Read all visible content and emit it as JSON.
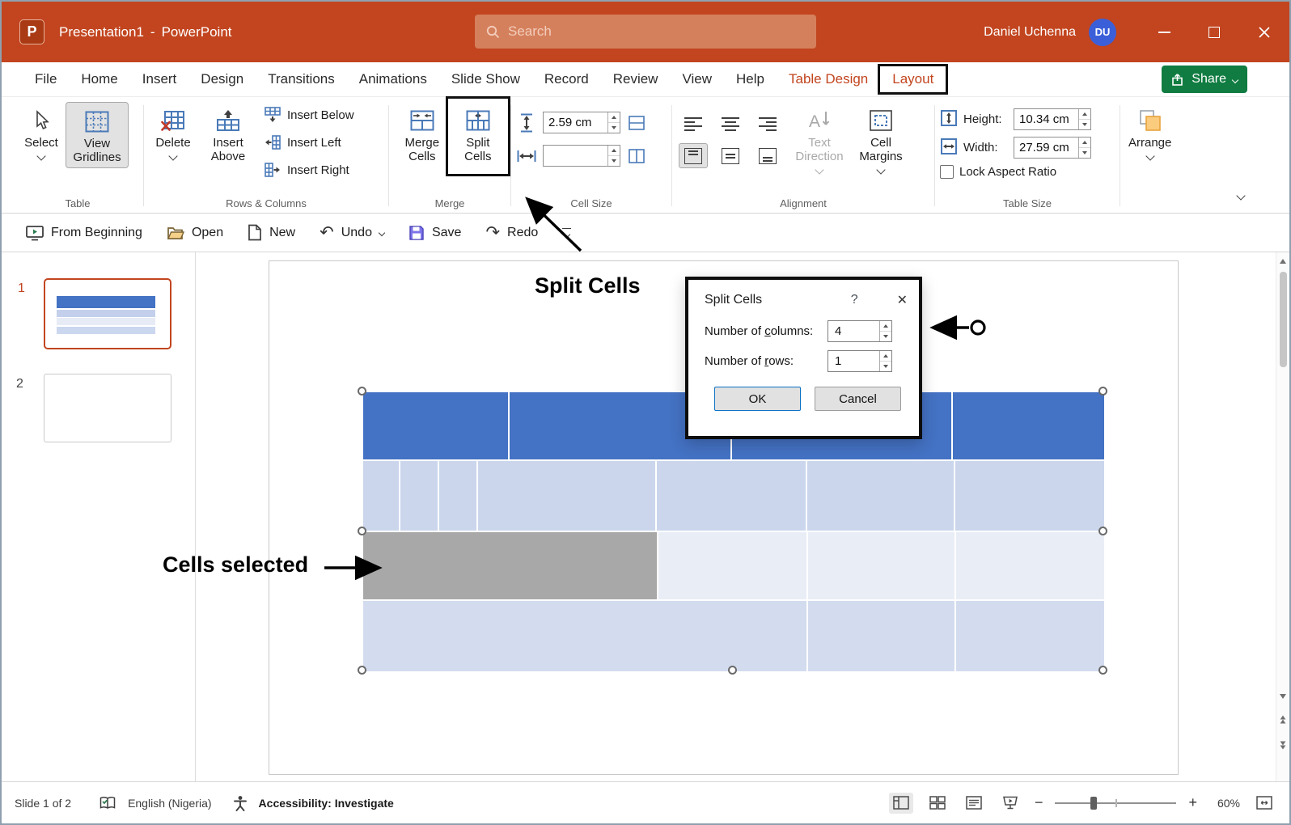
{
  "colors": {
    "titlebar": "#C2451F",
    "contextual_tab": "#C2451F",
    "share_green": "#107C41",
    "avatar_blue": "#3B5FD9",
    "table_header_blue": "#4472C4",
    "row_medium": "#CBD6EC",
    "row_light": "#E9EDF6",
    "row_bottom": "#D3DCEF",
    "selected_cells_gray": "#A8A8A8"
  },
  "title_bar": {
    "doc_name": "Presentation1",
    "separator": "-",
    "app_name": "PowerPoint",
    "logo_letter": "P",
    "search_placeholder": "Search",
    "user_name": "Daniel Uchenna",
    "user_initials": "DU"
  },
  "menu": {
    "tabs": [
      {
        "label": "File"
      },
      {
        "label": "Home"
      },
      {
        "label": "Insert"
      },
      {
        "label": "Design"
      },
      {
        "label": "Transitions"
      },
      {
        "label": "Animations"
      },
      {
        "label": "Slide Show"
      },
      {
        "label": "Record"
      },
      {
        "label": "Review"
      },
      {
        "label": "View"
      },
      {
        "label": "Help"
      },
      {
        "label": "Table Design"
      },
      {
        "label": "Layout"
      }
    ],
    "share_label": "Share"
  },
  "ribbon": {
    "table_group": {
      "select": "Select",
      "view_gridlines": "View Gridlines",
      "label": "Table"
    },
    "rows_columns_group": {
      "delete": "Delete",
      "insert_above": "Insert Above",
      "insert_below": "Insert Below",
      "insert_left": "Insert Left",
      "insert_right": "Insert Right",
      "label": "Rows & Columns"
    },
    "merge_group": {
      "merge_cells": "Merge Cells",
      "split_cells": "Split Cells",
      "label": "Merge"
    },
    "cell_size_group": {
      "height_value": "2.59 cm",
      "width_value": "",
      "label": "Cell Size"
    },
    "alignment_group": {
      "text_direction": "Text Direction",
      "cell_margins": "Cell Margins",
      "label": "Alignment"
    },
    "table_size_group": {
      "height_label": "Height:",
      "height_value": "10.34 cm",
      "width_label": "Width:",
      "width_value": "27.59 cm",
      "lock_aspect_ratio": "Lock Aspect Ratio",
      "label": "Table Size"
    },
    "arrange_group": {
      "arrange": "Arrange"
    }
  },
  "quick_access": {
    "from_beginning": "From Beginning",
    "open": "Open",
    "new": "New",
    "undo": "Undo",
    "undo_glyph": "↶",
    "save": "Save",
    "redo": "Redo",
    "redo_glyph": "↷"
  },
  "slides_panel": {
    "slide1_number": "1",
    "slide2_number": "2"
  },
  "annotations": {
    "split_cells_callout": "Split Cells",
    "cells_selected_callout": "Cells selected"
  },
  "dialog": {
    "title": "Split Cells",
    "help_glyph": "?",
    "close_glyph": "✕",
    "columns_label_pre": "Number of ",
    "columns_label_accel": "c",
    "columns_label_post": "olumns:",
    "columns_value": "4",
    "rows_label_pre": "Number of ",
    "rows_label_accel": "r",
    "rows_label_post": "ows:",
    "rows_value": "1",
    "ok_label": "OK",
    "cancel_label": "Cancel"
  },
  "status_bar": {
    "slide_indicator": "Slide 1 of 2",
    "language": "English (Nigeria)",
    "accessibility": "Accessibility: Investigate",
    "zoom_out_glyph": "−",
    "zoom_in_glyph": "+",
    "zoom_level": "60%"
  }
}
